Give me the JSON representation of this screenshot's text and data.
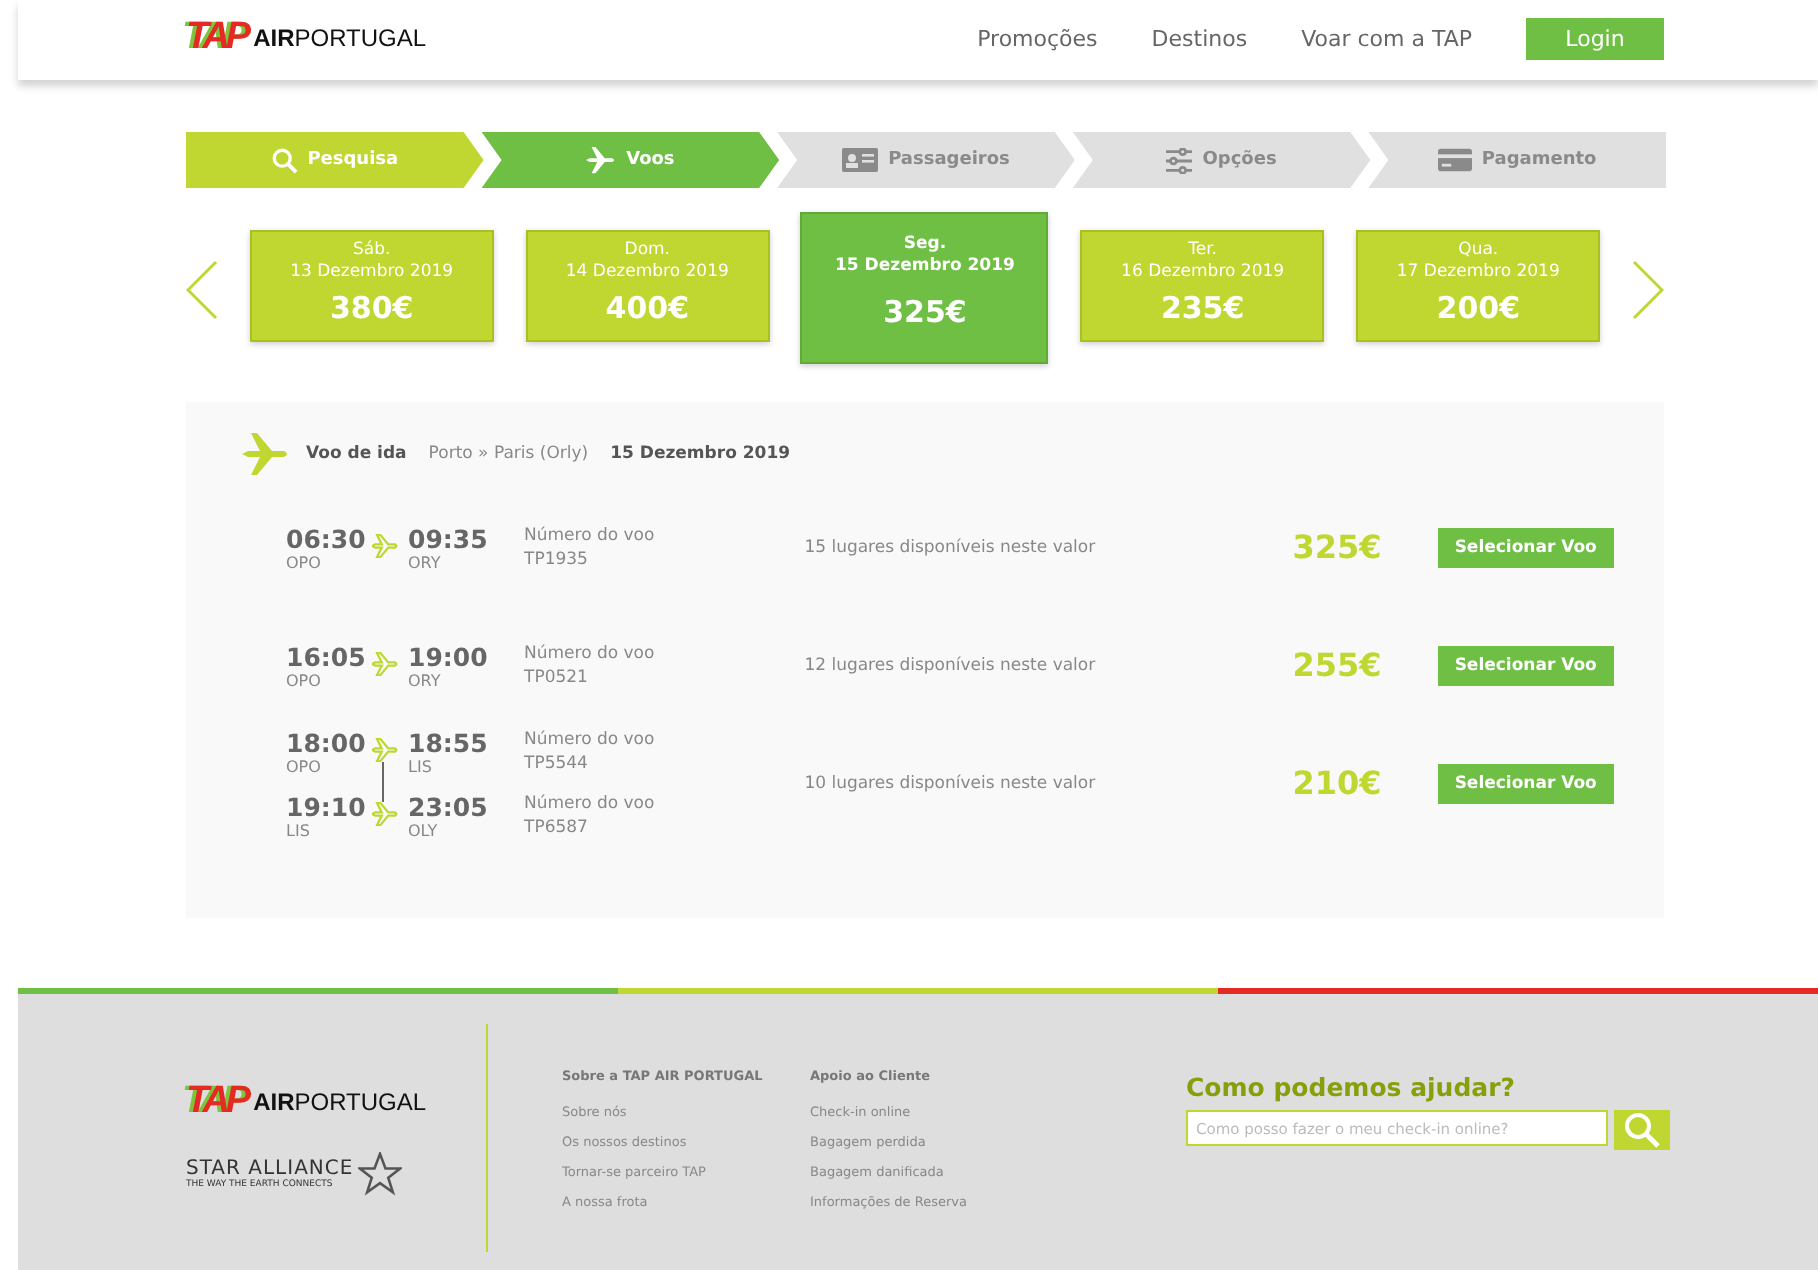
{
  "header": {
    "logo_mark": "TAP",
    "logo_text": "**AIR**PORTUGAL",
    "nav": [
      "Promoções",
      "Destinos",
      "Voar com a TAP"
    ],
    "login": "Login"
  },
  "steps": [
    {
      "label": "Pesquisa",
      "completed": true,
      "selected": false
    },
    {
      "label": "Voos",
      "completed": false,
      "selected": true
    },
    {
      "label": "Passageiros",
      "completed": false,
      "selected": false
    },
    {
      "label": "Opções",
      "completed": false,
      "selected": false
    },
    {
      "label": "Pagamento",
      "completed": false,
      "selected": false
    }
  ],
  "dates": [
    {
      "day": "Sáb.",
      "date": "13 Dezembro 2019",
      "price": "380€",
      "selected": false
    },
    {
      "day": "Dom.",
      "date": "14 Dezembro 2019",
      "price": "400€",
      "selected": false
    },
    {
      "day": "Seg.",
      "date": "15 Dezembro 2019",
      "price": "325€",
      "selected": true
    },
    {
      "day": "Ter.",
      "date": "16 Dezembro 2019",
      "price": "235€",
      "selected": false
    },
    {
      "day": "Qua.",
      "date": "17 Dezembro 2019",
      "price": "200€",
      "selected": false
    }
  ],
  "results": {
    "title": "Voo de ida",
    "route": "Porto » Paris (Orly)",
    "date": "15 Dezembro 2019",
    "flights": [
      {
        "segments": [
          {
            "dep_time": "06:30",
            "dep_code": "OPO",
            "arr_time": "09:35",
            "arr_code": "ORY",
            "number_label": "Número do voo",
            "number": "TP1935"
          }
        ],
        "availability": "15 lugares disponíveis neste valor",
        "price": "325€",
        "button": "Selecionar Voo"
      },
      {
        "segments": [
          {
            "dep_time": "16:05",
            "dep_code": "OPO",
            "arr_time": "19:00",
            "arr_code": "ORY",
            "number_label": "Número do voo",
            "number": "TP0521"
          }
        ],
        "availability": "12 lugares disponíveis neste valor",
        "price": "255€",
        "button": "Selecionar Voo"
      },
      {
        "segments": [
          {
            "dep_time": "18:00",
            "dep_code": "OPO",
            "arr_time": "18:55",
            "arr_code": "LIS",
            "number_label": "Número do voo",
            "number": "TP5544"
          },
          {
            "dep_time": "19:10",
            "dep_code": "LIS",
            "arr_time": "23:05",
            "arr_code": "OLY",
            "number_label": "Número do voo",
            "number": "TP6587"
          }
        ],
        "availability": "10 lugares disponíveis neste valor",
        "price": "210€",
        "button": "Selecionar Voo"
      }
    ]
  },
  "footer": {
    "logo_mark": "TAP",
    "logo_text": "**AIR**PORTUGAL",
    "alliance": "STAR ALLIANCE",
    "alliance_tagline": "THE WAY THE EARTH CONNECTS",
    "columns": [
      {
        "title": "Sobre a TAP AIR PORTUGAL",
        "links": [
          "Sobre nós",
          "Os nossos destinos",
          "Tornar-se parceiro TAP",
          "A nossa frota"
        ]
      },
      {
        "title": "Apoio ao Cliente",
        "links": [
          "Check-in online",
          "Bagagem perdida",
          "Bagagem danificada",
          "Informações de Reserva"
        ]
      }
    ],
    "help_title": "Como podemos ajudar?",
    "search_placeholder": "Como posso fazer o meu check-in online?"
  }
}
